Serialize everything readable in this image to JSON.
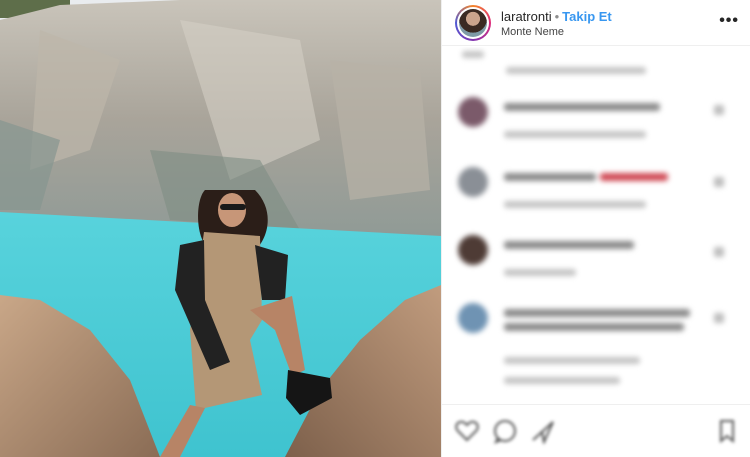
{
  "header": {
    "username": "laratronti",
    "separator": "•",
    "follow_label": "Takip Et",
    "location": "Monte Neme",
    "more_icon": "more-options-icon",
    "more_label": "•••"
  },
  "colors": {
    "follow_blue": "#3897f0",
    "lake_turquoise": "#4fd0d8",
    "border": "#efefef"
  },
  "comments_state": "blurred",
  "actions": {
    "icons": [
      "heart-icon",
      "comment-icon",
      "share-icon",
      "bookmark-icon"
    ]
  }
}
